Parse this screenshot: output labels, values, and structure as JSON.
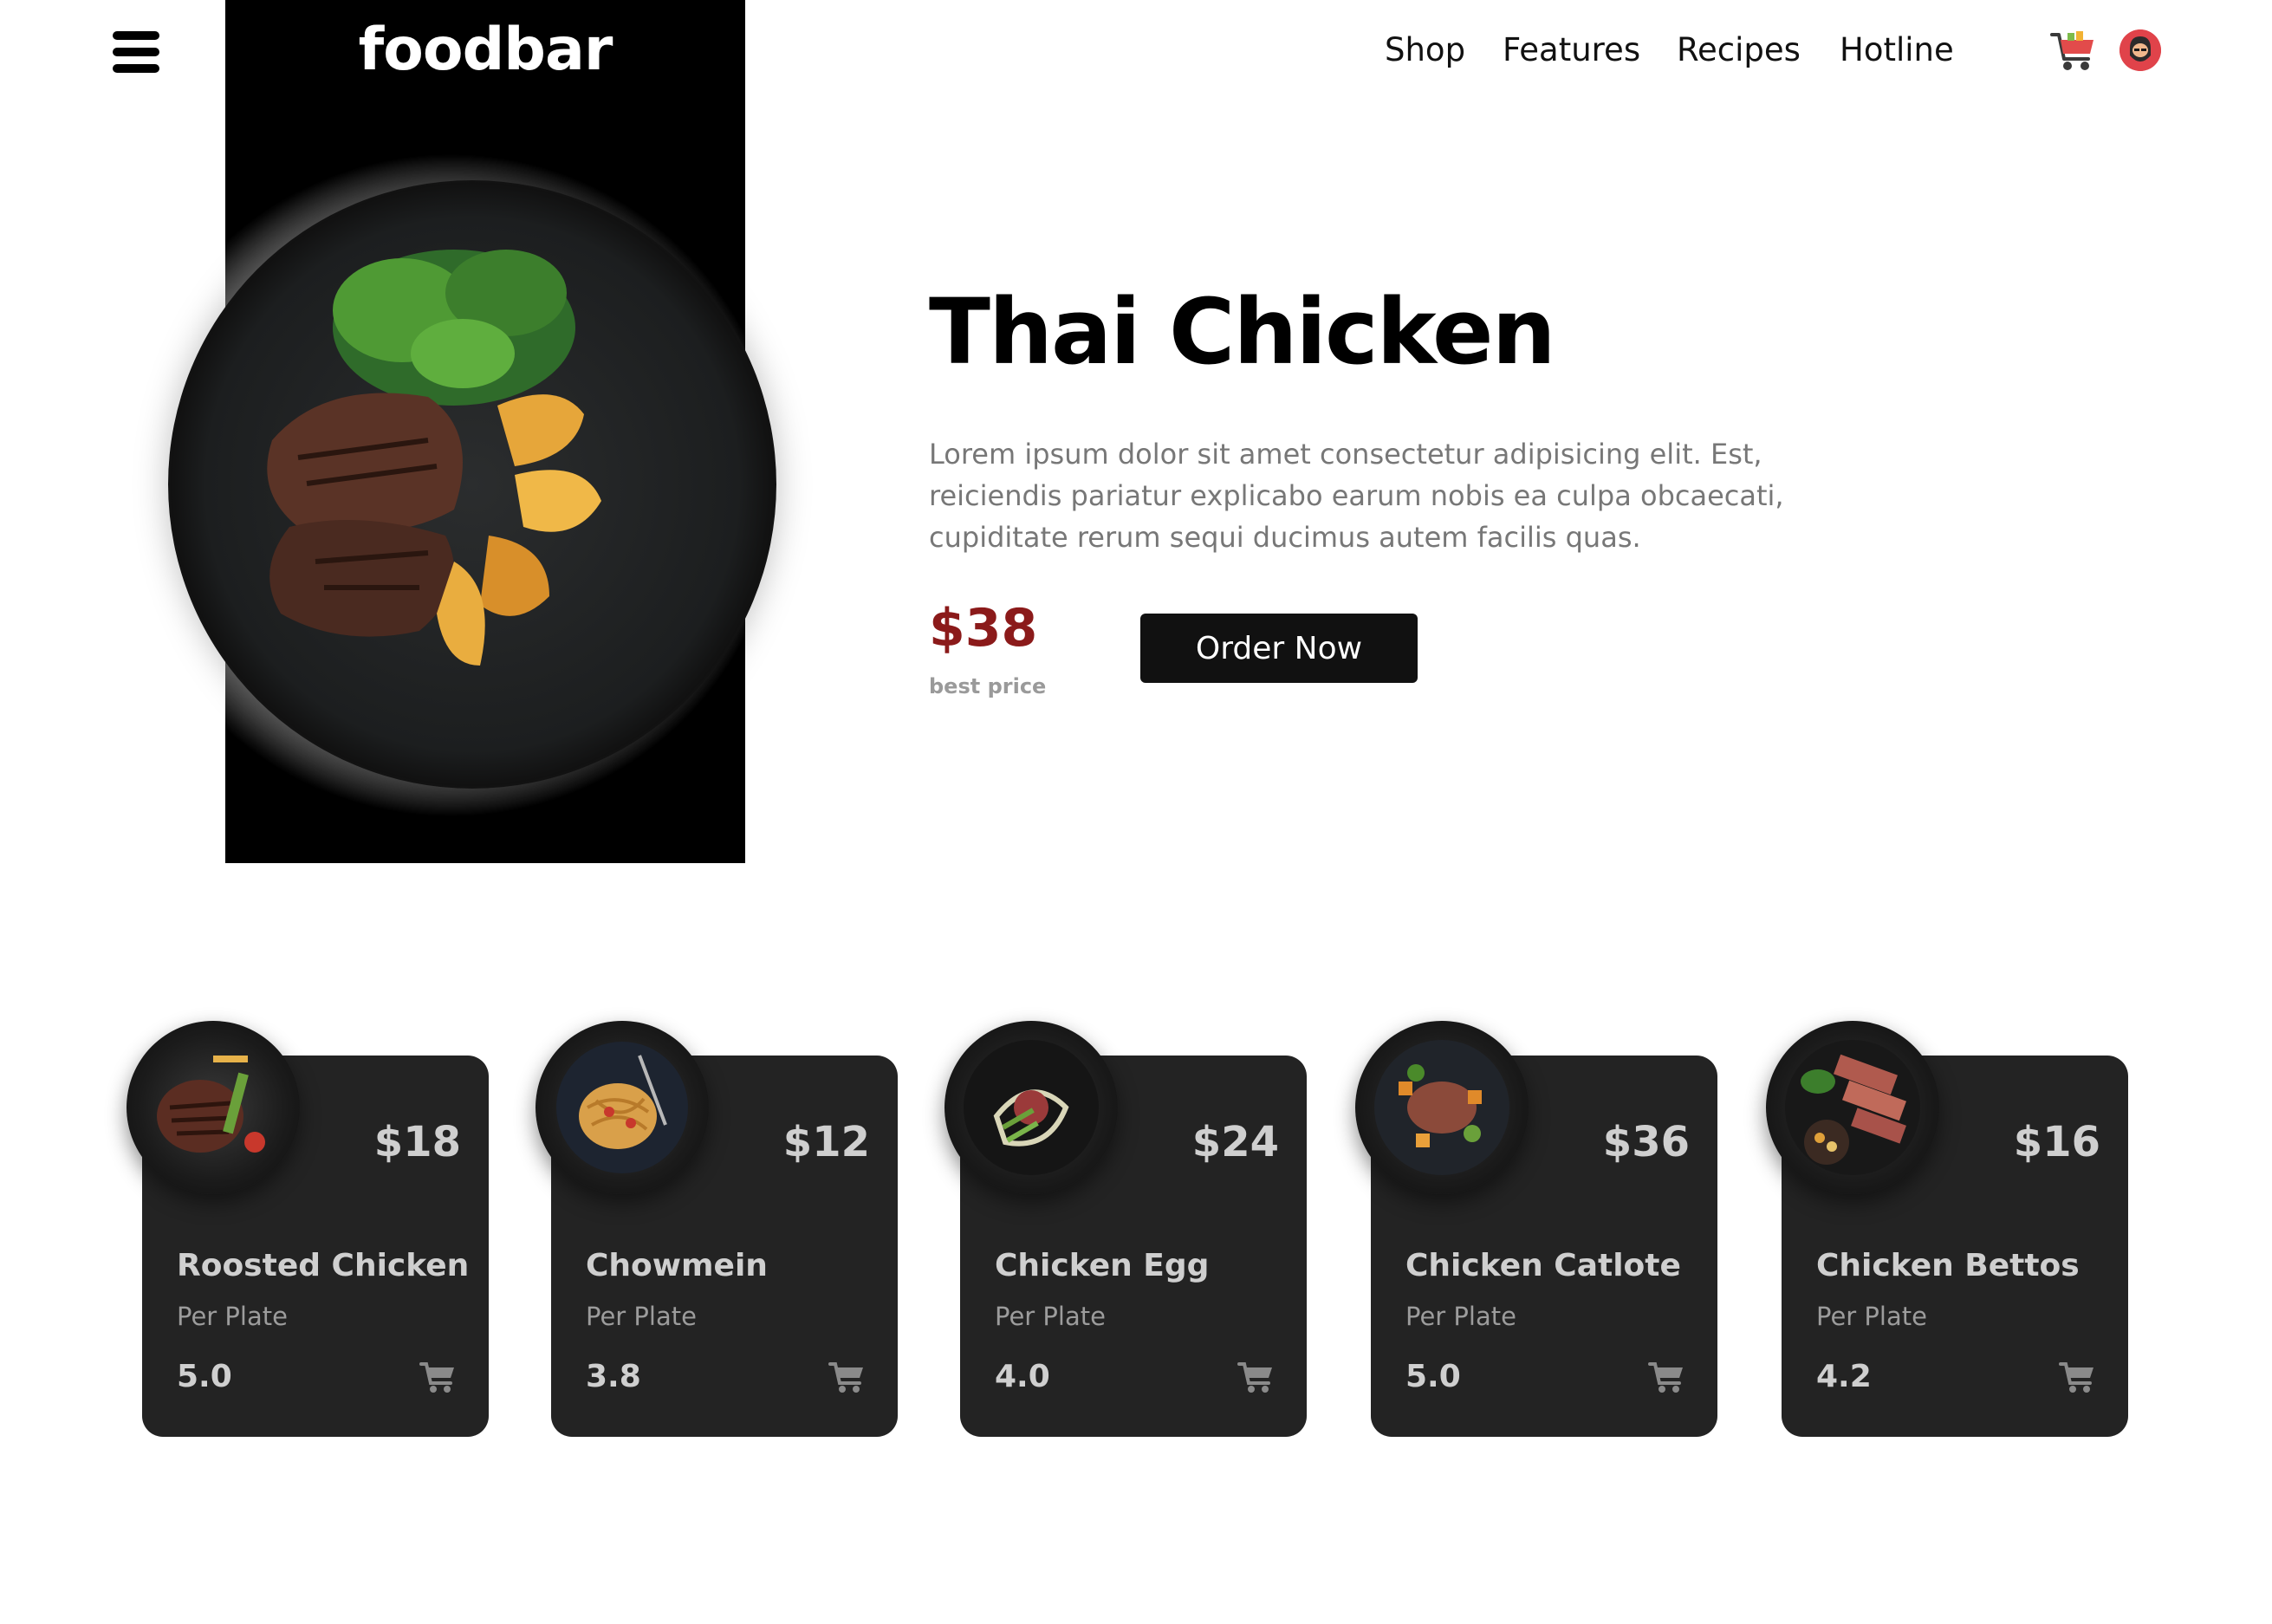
{
  "header": {
    "logo": "foodbar",
    "nav": [
      "Shop",
      "Features",
      "Recipes",
      "Hotline"
    ],
    "icons": [
      "menu-icon",
      "cart-icon",
      "avatar"
    ]
  },
  "hero": {
    "title": "Thai Chicken",
    "description": "Lorem ipsum dolor sit amet consectetur adipisicing elit. Est, reiciendis pariatur explicabo earum nobis ea culpa obcaecati, cupiditate rerum sequi ducimus autem facilis quas.",
    "price": "$38",
    "price_note": "best price",
    "order_button": "Order Now"
  },
  "cards": [
    {
      "price": "$18",
      "name": "Roosted Chicken",
      "sub": "Per Plate",
      "rating": "5.0"
    },
    {
      "price": "$12",
      "name": "Chowmein",
      "sub": "Per Plate",
      "rating": "3.8"
    },
    {
      "price": "$24",
      "name": "Chicken Egg",
      "sub": "Per Plate",
      "rating": "4.0"
    },
    {
      "price": "$36",
      "name": "Chicken Catlote",
      "sub": "Per Plate",
      "rating": "5.0"
    },
    {
      "price": "$16",
      "name": "Chicken Bettos",
      "sub": "Per Plate",
      "rating": "4.2"
    }
  ],
  "colors": {
    "accent_price": "#8b1a1a",
    "card_bg": "#232323",
    "button_bg": "#111111",
    "cart_icon": "#e24b4b"
  }
}
